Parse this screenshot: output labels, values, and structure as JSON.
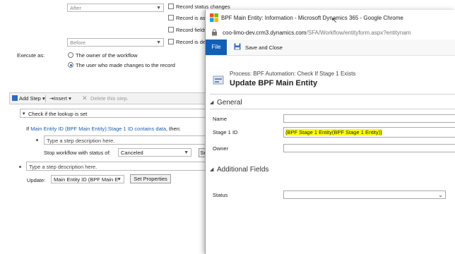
{
  "workflow_bg": {
    "status_selects": [
      {
        "value": "After"
      },
      {
        "value": "Before"
      }
    ],
    "checkboxes": [
      {
        "label": "Record status changes"
      },
      {
        "label": "Record is ass"
      },
      {
        "label": "Record fields"
      },
      {
        "label": "Record is del"
      }
    ],
    "execute_as_label": "Execute as:",
    "radio_owner": "The owner of the workflow",
    "radio_user": "The user who made changes to the record"
  },
  "steps_toolbar": {
    "add_step": "Add Step",
    "insert": "Insert",
    "delete": "Delete this step."
  },
  "steps": {
    "condition_title": "Check if the lookup is set",
    "condition_text_prefix": "If",
    "condition_link": "Main Entity ID (BPF Main Entity):Stage 1 ID contains data",
    "condition_suffix": ", then:",
    "step_desc_placeholder": "Type a step description here.",
    "stop_label": "Stop workflow with status of:",
    "stop_value": "Canceled",
    "set_btn": "Se",
    "step2_placeholder": "Type a step description here.",
    "update_label": "Update:",
    "update_value": "Main Entity ID (BPF Main E",
    "set_properties": "Set Properties"
  },
  "chrome": {
    "title": "BPF Main Entity: Information - Microsoft Dynamics 365 - Google Chrome",
    "url_host": "coo-limo-dev.crm3.dynamics.com",
    "url_path": "/SFA/Workflow/entityform.aspx?entitynam"
  },
  "form": {
    "file_tab": "File",
    "save_close": "Save and Close",
    "process_label": "Process: BPF Automation: Check If Stage 1 Exists",
    "title": "Update BPF Main Entity",
    "section_general": "General",
    "name_label": "Name",
    "stage1_label": "Stage 1 ID",
    "stage1_value": "{BPF Stage 1 Entity(BPF Stage 1 Entity)}",
    "owner_label": "Owner",
    "section_additional": "Additional Fields",
    "status_label": "Status"
  },
  "colors": {
    "accent": "#1160b7",
    "link": "#1a5fb4",
    "highlight": "#ffff00"
  }
}
